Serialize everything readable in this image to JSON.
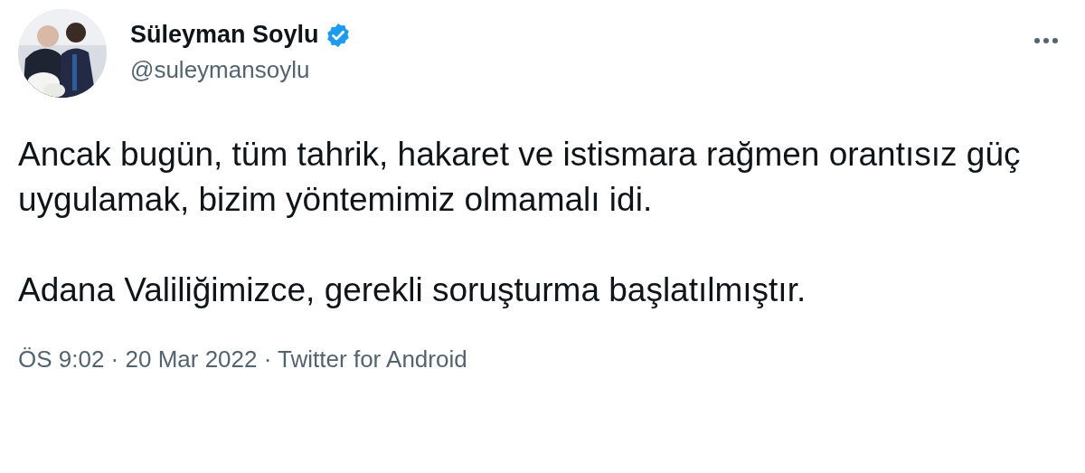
{
  "author": {
    "name": "Süleyman Soylu",
    "handle": "@suleymansoylu",
    "verified": true
  },
  "body": {
    "paragraphs": [
      "Ancak bugün, tüm tahrik, hakaret ve istismara rağmen orantısız güç uygulamak, bizim yöntemimiz olmamalı idi.",
      "Adana Valiliğimizce, gerekli soruşturma başlatılmıştır."
    ]
  },
  "meta": "ÖS 9:02 · 20 Mar 2022 · Twitter for Android"
}
